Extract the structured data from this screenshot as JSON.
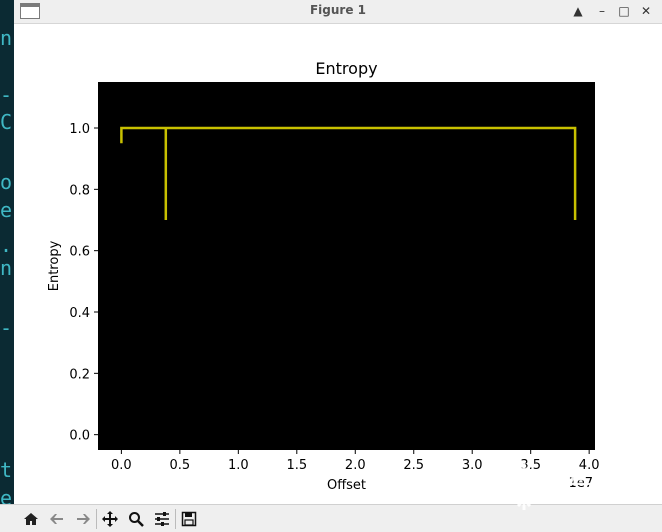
{
  "window": {
    "title": "Figure 1",
    "buttons": [
      "▲",
      "–",
      "□",
      "✕"
    ]
  },
  "terminal": {
    "chars": [
      "n",
      "-",
      "C",
      "o",
      "e",
      ".",
      "n",
      "-",
      "t",
      "e"
    ]
  },
  "chart_data": {
    "type": "line",
    "title": "Entropy",
    "xlabel": "Offset",
    "ylabel": "Entropy",
    "x_offset_label": "1e7",
    "xlim": [
      -0.2,
      4.05
    ],
    "ylim": [
      -0.05,
      1.15
    ],
    "xticks": [
      0.0,
      0.5,
      1.0,
      1.5,
      2.0,
      2.5,
      3.0,
      3.5,
      4.0
    ],
    "xtick_labels": [
      "0.0",
      "0.5",
      "1.0",
      "1.5",
      "2.0",
      "2.5",
      "3.0",
      "3.5",
      "4.0"
    ],
    "yticks": [
      0.0,
      0.2,
      0.4,
      0.6,
      0.8,
      1.0
    ],
    "ytick_labels": [
      "0.0",
      "0.2",
      "0.4",
      "0.6",
      "0.8",
      "1.0"
    ],
    "background": "#000000",
    "line_color": "#c8c000",
    "series": [
      {
        "x": [
          0.0,
          0.0,
          0.38,
          0.38,
          0.38,
          3.88,
          3.88
        ],
        "y": [
          0.95,
          1.0,
          1.0,
          0.7,
          1.0,
          1.0,
          0.7
        ]
      }
    ]
  },
  "toolbar": {
    "items": [
      "home-icon",
      "back-icon",
      "forward-icon",
      "pan-icon",
      "zoom-icon",
      "configure-icon",
      "save-icon"
    ]
  },
  "watermark": {
    "text": "看雪"
  }
}
